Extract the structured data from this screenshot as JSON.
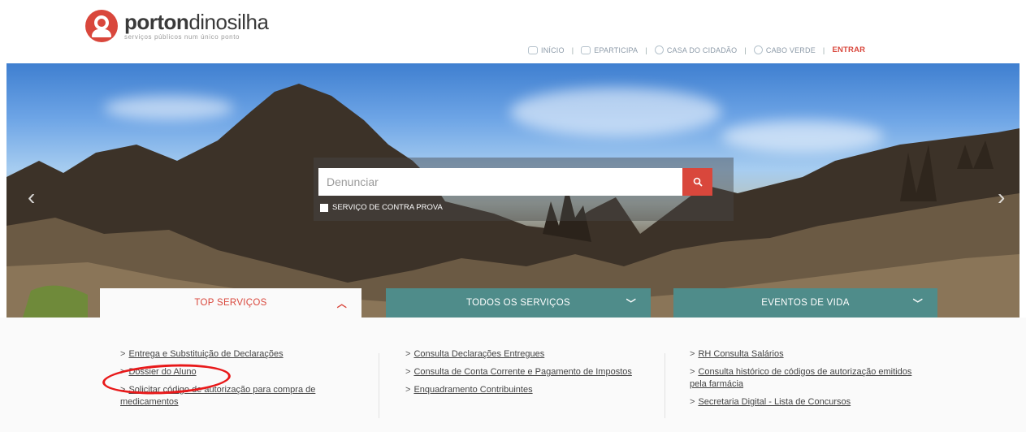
{
  "brand": {
    "title_bold": "porton",
    "title_light": "dinosilha",
    "tagline": "serviços públicos num único ponto",
    "accent_color": "#d9473c",
    "teal_color": "#4f8c8a"
  },
  "topnav": {
    "items": [
      {
        "label": "INÍCIO",
        "icon": "home-icon"
      },
      {
        "label": "EPARTICIPA",
        "icon": "chat-bubble-icon"
      },
      {
        "label": "CASA DO CIDADÃO",
        "icon": "citizen-house-icon"
      },
      {
        "label": "CABO VERDE",
        "icon": "flag-emblem-icon"
      }
    ],
    "login": "ENTRAR"
  },
  "search": {
    "placeholder": "Denunciar",
    "checkbox_label": "SERVIÇO DE CONTRA PROVA"
  },
  "tabs": {
    "top": "TOP SERVIÇOS",
    "all": "TODOS OS SERVIÇOS",
    "life": "EVENTOS DE VIDA"
  },
  "columns": {
    "col1": [
      "Entrega e Substituição de Declarações",
      "Dossier do Aluno",
      "Solicitar código de autorização para compra de medicamentos"
    ],
    "col2": [
      "Consulta Declarações Entregues",
      "Consulta de Conta Corrente e Pagamento de Impostos",
      "Enquadramento Contribuintes"
    ],
    "col3": [
      "RH Consulta Salários",
      "Consulta histórico de códigos de autorização emitidos pela farmácia",
      "Secretaria Digital - Lista de Concursos"
    ]
  }
}
